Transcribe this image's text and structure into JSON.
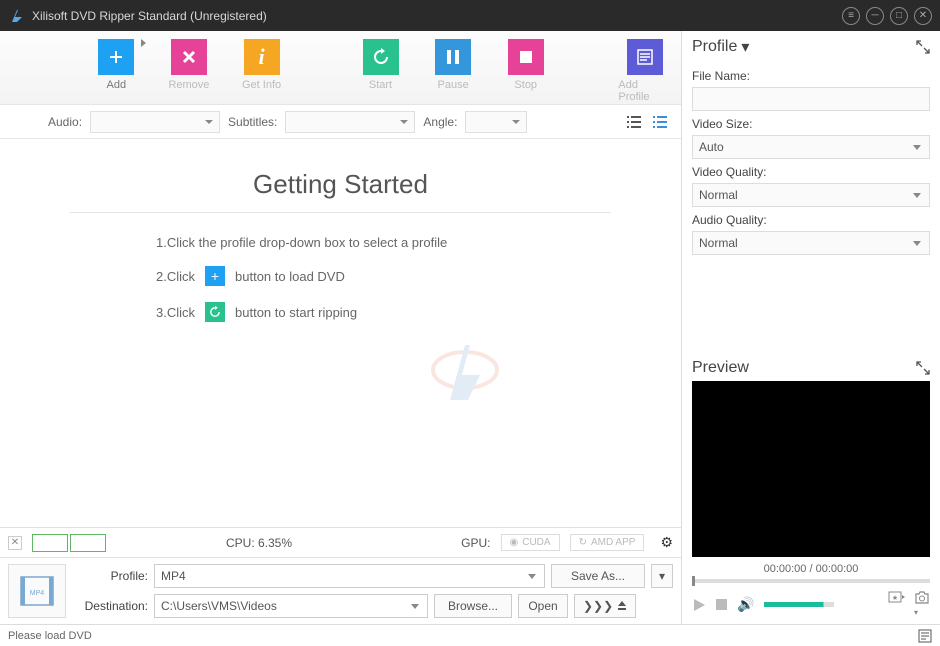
{
  "window": {
    "title": "Xilisoft DVD Ripper Standard (Unregistered)"
  },
  "toolbar": {
    "add": "Add",
    "remove": "Remove",
    "getinfo": "Get Info",
    "start": "Start",
    "pause": "Pause",
    "stop": "Stop",
    "addprofile": "Add Profile"
  },
  "filters": {
    "audio_label": "Audio:",
    "subtitles_label": "Subtitles:",
    "angle_label": "Angle:"
  },
  "getting_started": {
    "title": "Getting Started",
    "step1": "1.Click the profile drop-down box to select a profile",
    "step2_a": "2.Click",
    "step2_b": "button to load DVD",
    "step3_a": "3.Click",
    "step3_b": "button to start ripping"
  },
  "cpu": {
    "label": "CPU: 6.35%",
    "gpu_label": "GPU:",
    "cuda": "CUDA",
    "amd": "AMD APP"
  },
  "bottom": {
    "profile_label": "Profile:",
    "profile_value": "MP4",
    "dest_label": "Destination:",
    "dest_value": "C:\\Users\\VMS\\Videos",
    "saveas": "Save As...",
    "browse": "Browse...",
    "open": "Open",
    "more": "❯❯❯"
  },
  "right": {
    "profile_title": "Profile",
    "filename_label": "File Name:",
    "videosize_label": "Video Size:",
    "videosize_value": "Auto",
    "videoquality_label": "Video Quality:",
    "videoquality_value": "Normal",
    "audioquality_label": "Audio Quality:",
    "audioquality_value": "Normal",
    "preview_title": "Preview",
    "time": "00:00:00 / 00:00:00"
  },
  "status": {
    "text": "Please load DVD"
  }
}
